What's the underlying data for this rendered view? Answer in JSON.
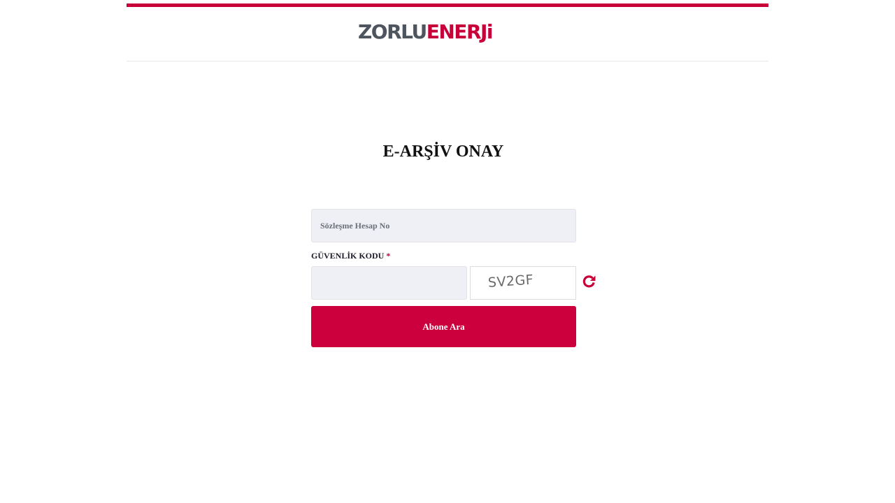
{
  "header": {
    "logo": {
      "part1": "ZORLU",
      "part2": "ENERJi"
    },
    "colors": {
      "brand_red": "#c8003a",
      "brand_gray": "#4e555e"
    }
  },
  "form": {
    "title": "E-ARŞİV ONAY",
    "account_field": {
      "placeholder": "Sözleşme Hesap No",
      "value": ""
    },
    "security": {
      "label": "GÜVENLİK KODU",
      "required_marker": "*",
      "input_value": "",
      "captcha_text": "SV2GF",
      "refresh_icon": "refresh-icon"
    },
    "submit_label": "Abone Ara"
  }
}
